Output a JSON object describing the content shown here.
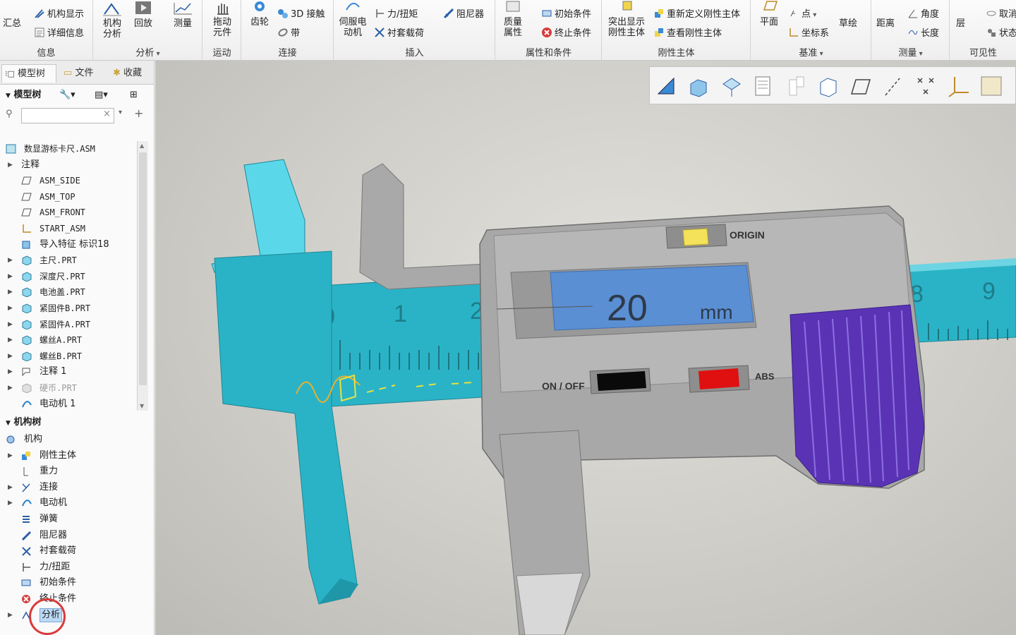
{
  "ribbon": {
    "info": {
      "label": "信息",
      "summary": "汇总",
      "mech_display": "机构显示",
      "details": "详细信息"
    },
    "analysis": {
      "label": "分析",
      "mech_analysis": "机构\n分析",
      "playback": "回放",
      "measure": "测量"
    },
    "motion": {
      "label": "运动",
      "drag": "拖动\n元件"
    },
    "connect": {
      "label": "连接",
      "gear": "齿轮",
      "contact3d": "3D 接触",
      "belt": "带"
    },
    "insert": {
      "label": "插入",
      "servo": "伺服电\n动机",
      "force": "力/扭矩",
      "bushing": "衬套载荷",
      "damper": "阻尼器"
    },
    "props": {
      "label": "属性和条件",
      "mass": "质量\n属性",
      "init_cond": "初始条件",
      "term_cond": "终止条件"
    },
    "body": {
      "label": "刚性主体",
      "highlight": "突出显示\n刚性主体",
      "redefine": "重新定义刚性主体",
      "view": "查看刚性主体"
    },
    "datum": {
      "label": "基准",
      "plane": "平面",
      "point": "点",
      "csys": "坐标系",
      "sketch": "草绘"
    },
    "measure": {
      "label": "测量",
      "distance": "距离",
      "angle": "角度",
      "length": "长度"
    },
    "visibility": {
      "label": "可见性",
      "layer": "层",
      "cancel": "取消",
      "status": "状态"
    }
  },
  "panel": {
    "tabs": [
      "模型树",
      "文件",
      "收藏"
    ],
    "model_tree_title": "模型树",
    "mech_tree_title": "机构树",
    "filter_placeholder": "",
    "model_items": [
      {
        "label": "数显游标卡尺.ASM",
        "icon": "assembly-icon",
        "expand": false,
        "indent": 0
      },
      {
        "label": "注释",
        "icon": "",
        "expand": true,
        "indent": 1
      },
      {
        "label": "ASM_SIDE",
        "icon": "datum-plane-icon",
        "expand": false,
        "indent": 1
      },
      {
        "label": "ASM_TOP",
        "icon": "datum-plane-icon",
        "expand": false,
        "indent": 1
      },
      {
        "label": "ASM_FRONT",
        "icon": "datum-plane-icon",
        "expand": false,
        "indent": 1
      },
      {
        "label": "START_ASM",
        "icon": "csys-icon",
        "expand": false,
        "indent": 1
      },
      {
        "label": "导入特征 标识18",
        "icon": "import-feature-icon",
        "expand": false,
        "indent": 1
      },
      {
        "label": "主尺.PRT",
        "icon": "part-icon",
        "expand": true,
        "indent": 1
      },
      {
        "label": "深度尺.PRT",
        "icon": "part-icon",
        "expand": true,
        "indent": 1
      },
      {
        "label": "电池盖.PRT",
        "icon": "part-icon",
        "expand": true,
        "indent": 1
      },
      {
        "label": "紧固件B.PRT",
        "icon": "part-icon",
        "expand": true,
        "indent": 1
      },
      {
        "label": "紧固件A.PRT",
        "icon": "part-icon",
        "expand": true,
        "indent": 1
      },
      {
        "label": "螺丝A.PRT",
        "icon": "part-icon",
        "expand": true,
        "indent": 1
      },
      {
        "label": "螺丝B.PRT",
        "icon": "part-icon",
        "expand": true,
        "indent": 1
      },
      {
        "label": "注释 1",
        "icon": "annotation-icon",
        "expand": true,
        "indent": 1
      },
      {
        "label": "硬币.PRT",
        "icon": "part-hidden-icon",
        "expand": true,
        "indent": 1
      },
      {
        "label": "电动机 1",
        "icon": "motor-icon",
        "expand": false,
        "indent": 1
      }
    ],
    "mech_items": [
      {
        "label": "机构",
        "icon": "mechanism-icon",
        "expand": false,
        "indent": 0
      },
      {
        "label": "刚性主体",
        "icon": "rigid-body-icon",
        "expand": true,
        "indent": 1
      },
      {
        "label": "重力",
        "icon": "gravity-icon",
        "expand": false,
        "indent": 1
      },
      {
        "label": "连接",
        "icon": "connection-icon",
        "expand": true,
        "indent": 1
      },
      {
        "label": "电动机",
        "icon": "motor-icon",
        "expand": true,
        "indent": 1
      },
      {
        "label": "弹簧",
        "icon": "spring-icon",
        "expand": false,
        "indent": 1
      },
      {
        "label": "阻尼器",
        "icon": "damper-icon",
        "expand": false,
        "indent": 1
      },
      {
        "label": "衬套载荷",
        "icon": "bushing-icon",
        "expand": false,
        "indent": 1
      },
      {
        "label": "力/扭距",
        "icon": "force-icon",
        "expand": false,
        "indent": 1
      },
      {
        "label": "初始条件",
        "icon": "init-cond-icon",
        "expand": false,
        "indent": 1
      },
      {
        "label": "终止条件",
        "icon": "term-cond-icon",
        "expand": false,
        "indent": 1
      },
      {
        "label": "分析",
        "icon": "analysis-icon",
        "expand": true,
        "indent": 1,
        "selected": true
      }
    ]
  },
  "viewport": {
    "display_value": "20",
    "display_unit": "mm",
    "origin_label": "ORIGIN",
    "onoff_label": "ON / OFF",
    "abs_label": "ABS",
    "scale_numbers": [
      "0",
      "1",
      "2",
      "8",
      "9"
    ],
    "colors": {
      "jaw": "#2ab3c6",
      "body": "#a8a8a8",
      "lcd": "#5b8fd4",
      "grip": "#5a33b5",
      "red_btn": "#e01010",
      "yellow_btn": "#f4e25a"
    },
    "toolbar_icons": [
      "refit-icon",
      "shading-icon",
      "view-manager-icon",
      "display-style-icon",
      "saved-orient-icon",
      "appearance-icon",
      "datum-plane-display-icon",
      "datum-axis-display-icon",
      "datum-point-display-icon",
      "csys-display-icon",
      "spin-center-icon"
    ]
  }
}
